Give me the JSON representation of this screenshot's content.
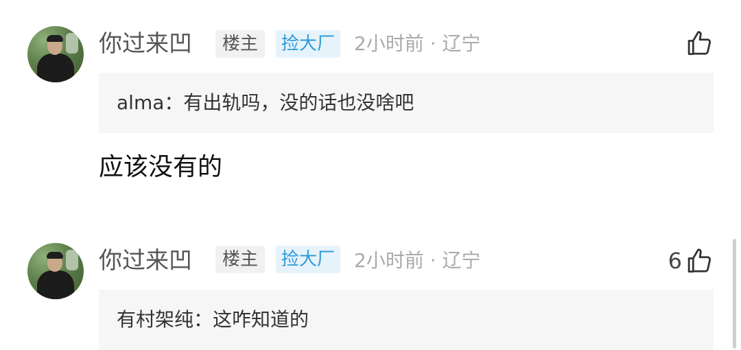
{
  "comments": [
    {
      "user": "你过来凹",
      "owner_tag": "楼主",
      "badge": "捡大厂",
      "meta": "2小时前 · 辽宁",
      "like_count": "",
      "icons": {
        "avatar": "user-avatar",
        "like": "thumbs-up-icon"
      },
      "quote_author": "alma：",
      "quote_text": "有出轨吗，没的话也没啥吧",
      "reply": "应该没有的"
    },
    {
      "user": "你过来凹",
      "owner_tag": "楼主",
      "badge": "捡大厂",
      "meta": "2小时前 · 辽宁",
      "like_count": "6",
      "icons": {
        "avatar": "user-avatar",
        "like": "thumbs-up-icon"
      },
      "quote_author": "有村架纯：",
      "quote_text": "这咋知道的",
      "reply": ""
    }
  ]
}
